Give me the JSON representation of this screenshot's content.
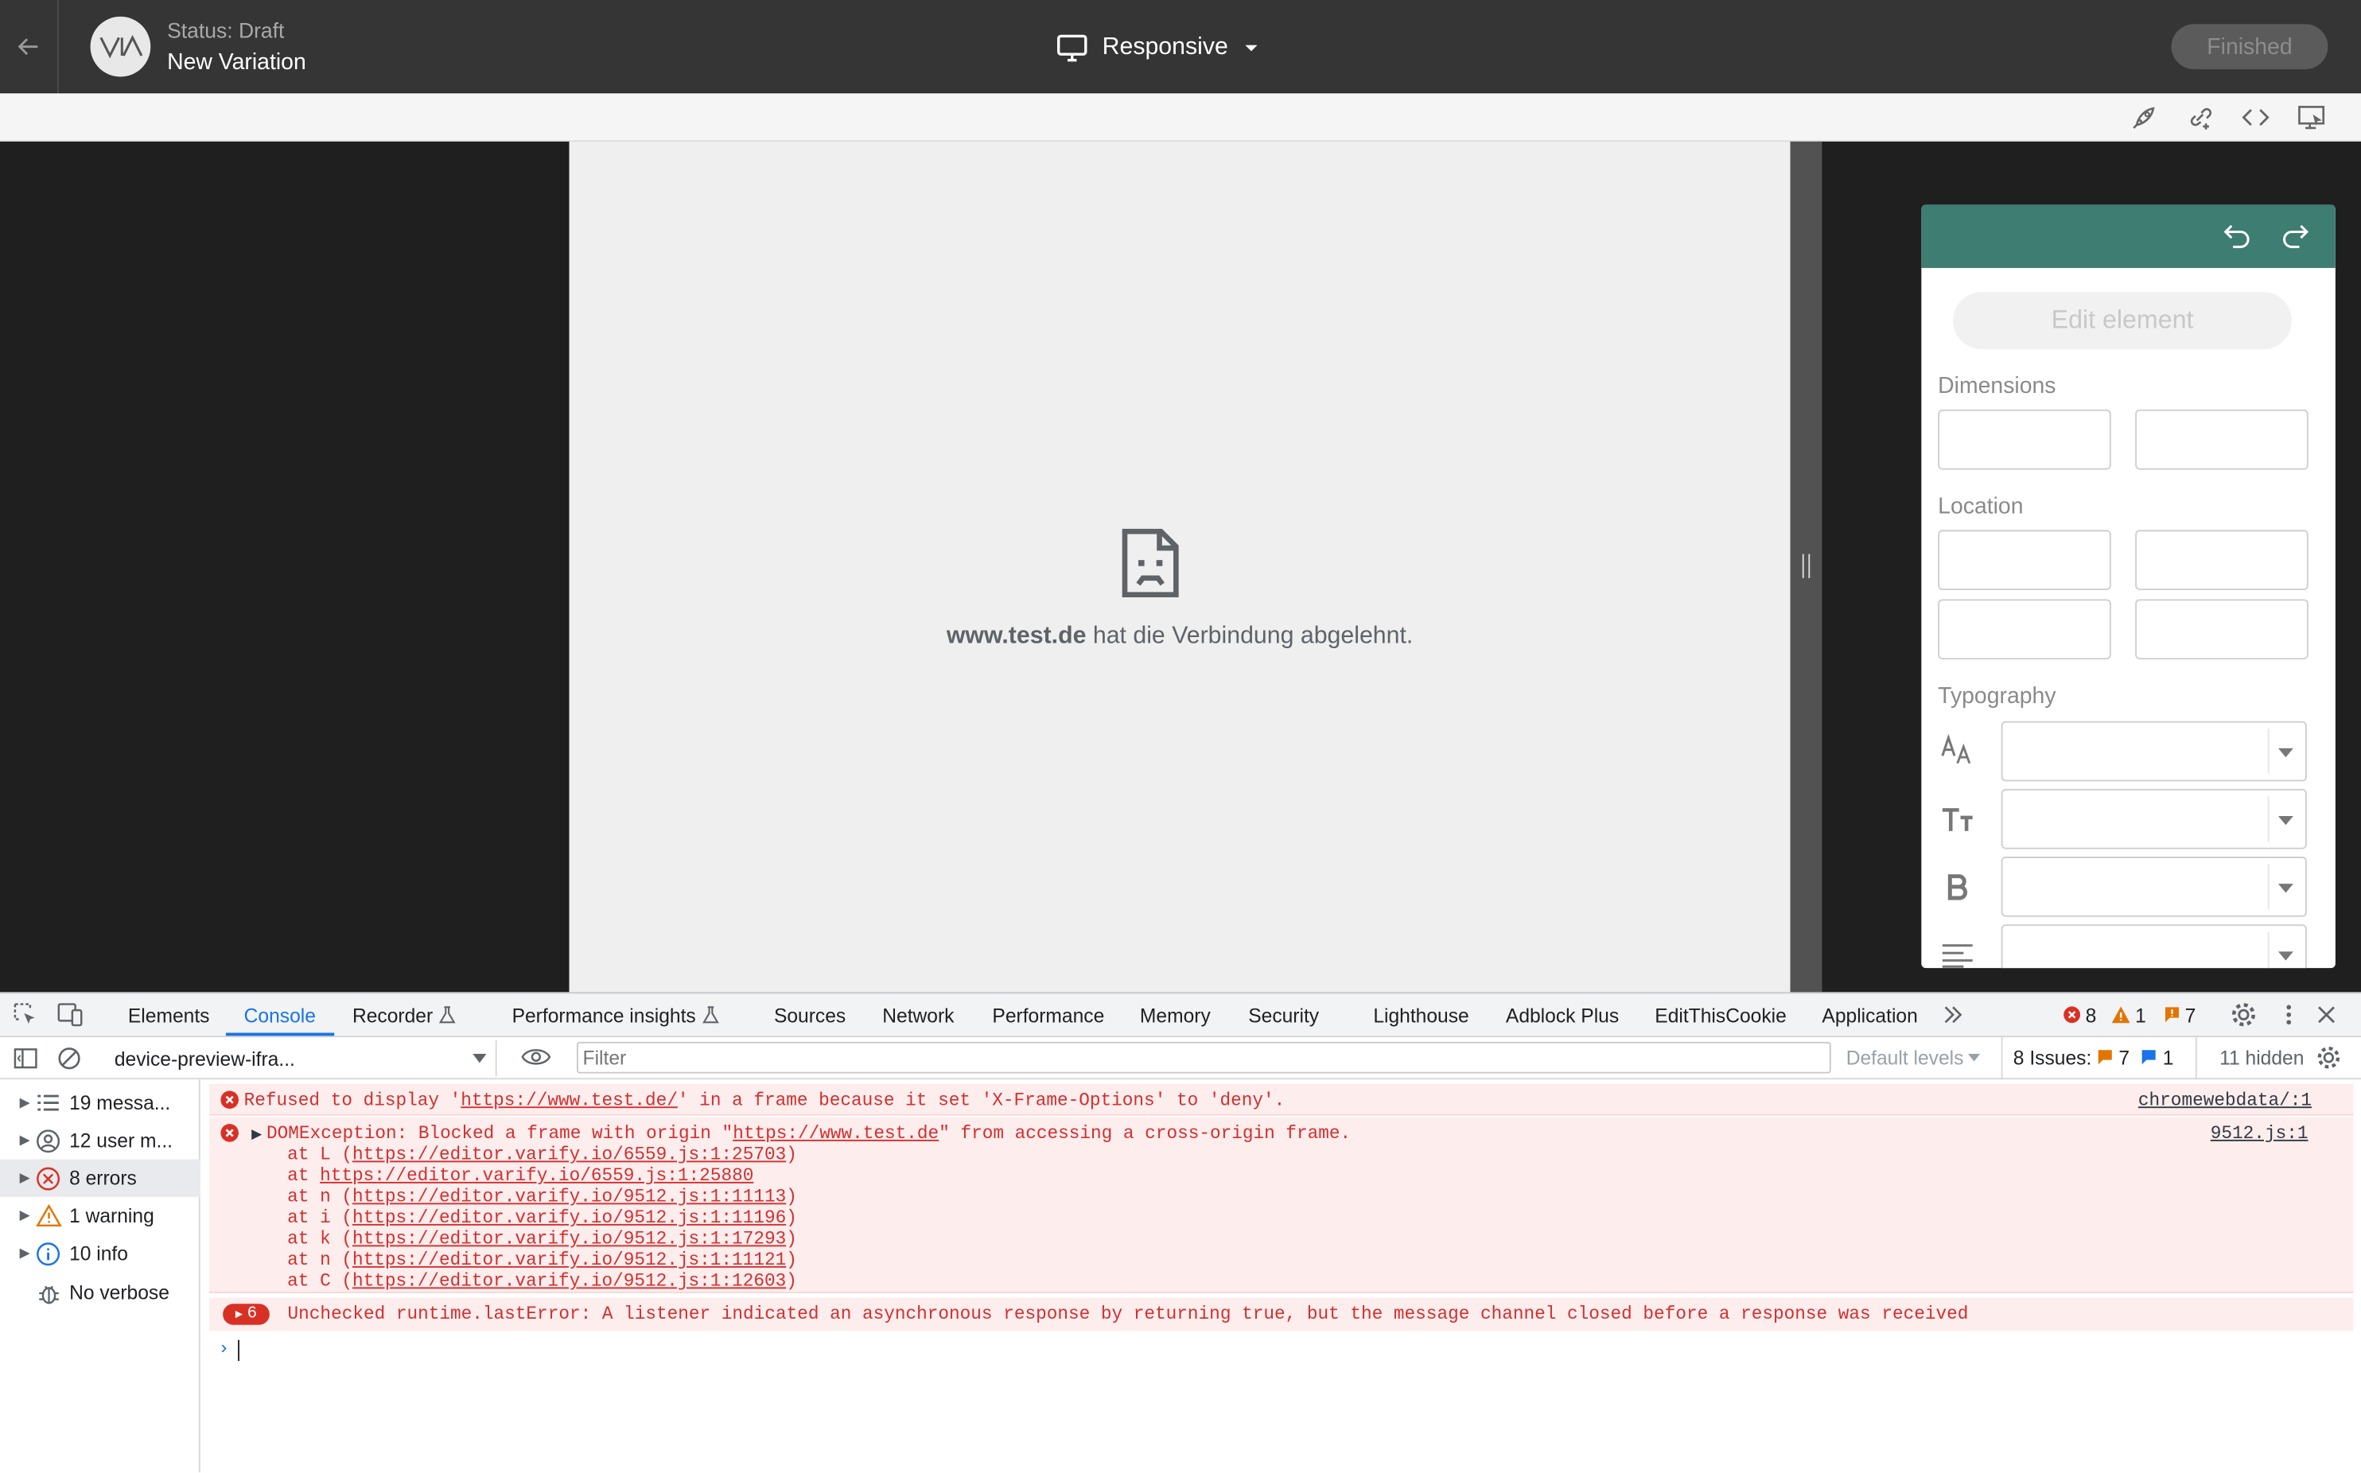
{
  "header": {
    "status": "Status: Draft",
    "variation_name": "New Variation",
    "device_label": "Responsive",
    "finished_label": "Finished"
  },
  "frame": {
    "error_host": "www.test.de",
    "error_text": " hat die Verbindung abgelehnt."
  },
  "panel": {
    "edit_label": "Edit element",
    "dimensions": "Dimensions",
    "location": "Location",
    "typography": "Typography",
    "accent": "#3d7d72"
  },
  "devtools": {
    "tabs": [
      "Elements",
      "Console",
      "Recorder",
      "Performance insights",
      "Sources",
      "Network",
      "Performance",
      "Memory",
      "Security",
      "Lighthouse",
      "Adblock Plus",
      "EditThisCookie",
      "Application"
    ],
    "counts": {
      "errors": "8",
      "warnings": "1",
      "issues": "7"
    },
    "context": "device-preview-ifra...",
    "filter_placeholder": "Filter",
    "levels": "Default levels",
    "issues_label": "8 Issues:",
    "issues_warn": "7",
    "issues_info": "1",
    "hidden": "11 hidden",
    "sidebar": [
      {
        "label": "19 messa...",
        "icon": "list-icon"
      },
      {
        "label": "12 user m...",
        "icon": "user-icon"
      },
      {
        "label": "8 errors",
        "icon": "error-icon"
      },
      {
        "label": "1 warning",
        "icon": "warning-icon"
      },
      {
        "label": "10 info",
        "icon": "info-icon"
      },
      {
        "label": "No verbose",
        "icon": "bug-icon"
      }
    ],
    "messages": {
      "m1_pre": "Refused to display '",
      "m1_url": "https://www.test.de/",
      "m1_post": "' in a frame because it set 'X-Frame-Options' to 'deny'.",
      "m1_src": "chromewebdata/:1",
      "m2_pre": "DOMException: Blocked a frame with origin \"",
      "m2_url": "https://www.test.de",
      "m2_post": "\" from accessing a cross-origin frame.",
      "m2_src": "9512.js:1",
      "stack": [
        {
          "pre": "    at L (",
          "url": "https://editor.varify.io/6559.js:1:25703",
          "post": ")"
        },
        {
          "pre": "    at ",
          "url": "https://editor.varify.io/6559.js:1:25880",
          "post": ""
        },
        {
          "pre": "    at n (",
          "url": "https://editor.varify.io/9512.js:1:11113",
          "post": ")"
        },
        {
          "pre": "    at i (",
          "url": "https://editor.varify.io/9512.js:1:11196",
          "post": ")"
        },
        {
          "pre": "    at k (",
          "url": "https://editor.varify.io/9512.js:1:17293",
          "post": ")"
        },
        {
          "pre": "    at n (",
          "url": "https://editor.varify.io/9512.js:1:11121",
          "post": ")"
        },
        {
          "pre": "    at C (",
          "url": "https://editor.varify.io/9512.js:1:12603",
          "post": ")"
        }
      ],
      "m3_count": "6",
      "m3": "Unchecked runtime.lastError: A listener indicated an asynchronous response by returning true, but the message channel closed before a response was received"
    }
  }
}
